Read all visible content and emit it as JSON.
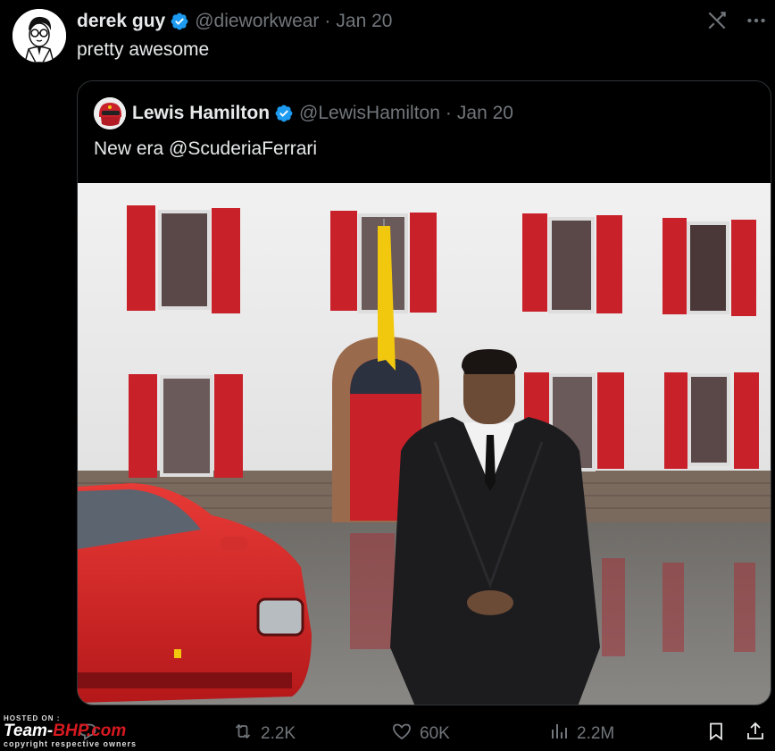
{
  "tweet": {
    "display_name": "derek guy",
    "handle": "@dieworkwear",
    "separator": "·",
    "date": "Jan 20",
    "text": "pretty awesome"
  },
  "quoted_tweet": {
    "display_name": "Lewis Hamilton",
    "handle": "@LewisHamilton",
    "separator": "·",
    "date": "Jan 20",
    "text": "New era @ScuderiaFerrari"
  },
  "actions": {
    "replies": "",
    "reposts": "2.2K",
    "likes": "60K",
    "views": "2.2M"
  },
  "watermark": {
    "hosted_on": "HOSTED ON :",
    "brand_part1": "Team-",
    "brand_part2": "BHP.com",
    "copyright": "copyright respective owners"
  },
  "icons": {
    "verified": "verified-badge-icon",
    "grok": "grok-icon",
    "more": "more-icon",
    "reply": "reply-icon",
    "repost": "repost-icon",
    "like": "heart-icon",
    "views": "views-icon",
    "bookmark": "bookmark-icon",
    "share": "share-icon"
  },
  "colors": {
    "background": "#000000",
    "text": "#e7e9ea",
    "muted": "#71767b",
    "verified_blue": "#1d9bf0",
    "border": "#2f3336",
    "ferrari_red": "#c8212a",
    "flag_yellow": "#f2c80f"
  }
}
